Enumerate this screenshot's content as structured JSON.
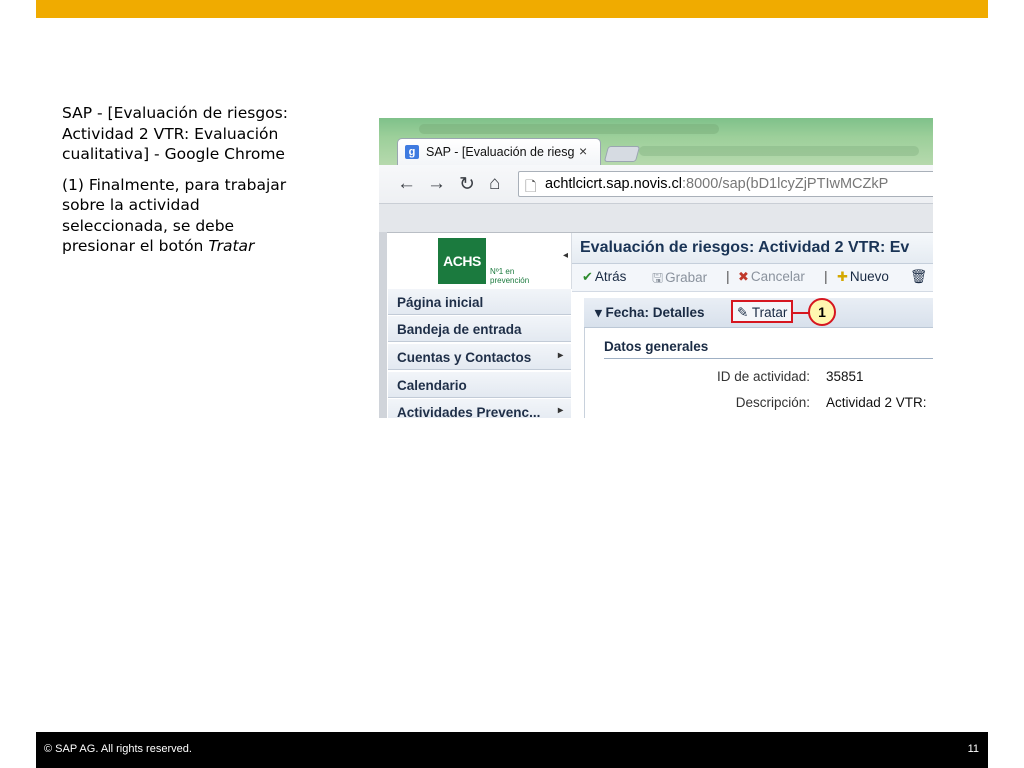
{
  "slide": {
    "title": "SAP - [Evaluación de riesgos: Actividad 2 VTR: Evaluación cualitativa] - Google Chrome",
    "instruction_text": "(1) Finalmente, para trabajar sobre la actividad seleccionada, se debe presionar el botón",
    "instruction_emph": "Tratar",
    "footer_copyright": "©  SAP AG. All rights reserved.",
    "page_number": "11",
    "colors": {
      "top_bar": "#f0ab00",
      "footer": "#000000",
      "highlight": "#d6161f"
    }
  },
  "browser": {
    "tab_title": "SAP - [Evaluación de riesg",
    "tab_close": "×",
    "tab_favicon": "g",
    "url_host": "achtlcicrt.sap.novis.cl",
    "url_path": ":8000/sap(bD1lcyZjPTIwMCZkP",
    "icons": {
      "back": "←",
      "forward": "→",
      "reload": "↻",
      "home": "⌂",
      "page": "🗋"
    }
  },
  "sap": {
    "logo_text": "ACHS",
    "logo_sub_line1": "Nº1 en",
    "logo_sub_line2": "prevención",
    "nav_items": [
      {
        "label": "Página inicial",
        "has_submenu": false
      },
      {
        "label": "Bandeja de entrada",
        "has_submenu": false
      },
      {
        "label": "Cuentas y Contactos",
        "has_submenu": true
      },
      {
        "label": "Calendario",
        "has_submenu": false
      },
      {
        "label": "Actividades Prevenc...",
        "has_submenu": true
      }
    ],
    "chevron": "▸",
    "page_title": "Evaluación de riesgos: Actividad 2 VTR: Ev",
    "actions": {
      "back": {
        "icon": "✔",
        "label": "Atrás"
      },
      "save": {
        "icon": "🖫",
        "label": "Grabar"
      },
      "cancel": {
        "icon": "✖",
        "label": "Cancelar"
      },
      "new": {
        "icon": "✚",
        "label": "Nuevo"
      },
      "delete_icon": "🗑",
      "separator": "|"
    },
    "panel_title": "▾ Fecha: Detalles",
    "tratar_icon": "✎",
    "tratar_label": "Tratar",
    "callout_number": "1",
    "section_title": "Datos generales",
    "fields": [
      {
        "label": "ID de actividad:",
        "value": "35851"
      },
      {
        "label": "Descripción:",
        "value": "Actividad 2 VTR:"
      }
    ]
  }
}
